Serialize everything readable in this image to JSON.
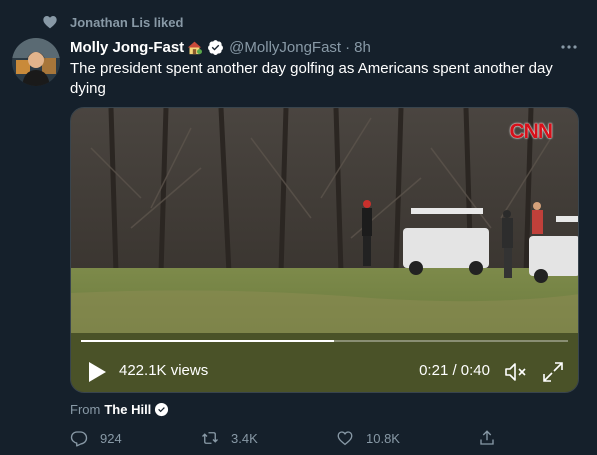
{
  "social_context": {
    "text": "Jonathan Lis liked",
    "icon": "heart-icon"
  },
  "tweet": {
    "author_name": "Molly Jong-Fast",
    "handle": "@MollyJongFast",
    "separator": "·",
    "time": "8h",
    "text": "The president spent another day golfing as Americans spent another day dying"
  },
  "video": {
    "watermark": "CNN",
    "views": "422.1K views",
    "timecode": "0:21 / 0:40",
    "progress": 0.52
  },
  "source": {
    "prefix": "From",
    "name": "The Hill"
  },
  "actions": {
    "reply_count": "924",
    "retweet_count": "3.4K",
    "like_count": "10.8K"
  },
  "colors": {
    "background": "#15202b",
    "secondary_text": "#8899a6",
    "verified_blue": "#ffffff",
    "cnn_red": "#d7101a"
  }
}
